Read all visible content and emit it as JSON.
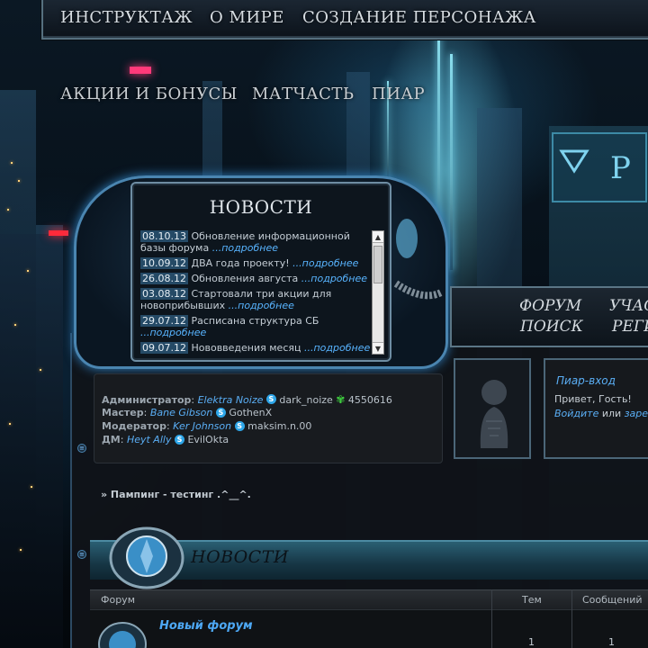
{
  "nav": {
    "row1": [
      "ИНСТРУКТАЖ",
      "О МИРЕ",
      "СОЗДАНИЕ ПЕРСОНАЖА"
    ],
    "row2": [
      "АКЦИИ И БОНУСЫ",
      "МАТЧАСТЬ",
      "ПИАР"
    ]
  },
  "news_widget": {
    "title": "НОВОСТИ",
    "more_label": "...подробнее",
    "items": [
      {
        "date": "08.10.13",
        "text": "Обновление информационной базы форума"
      },
      {
        "date": "10.09.12",
        "text": "ДВА года проекту!"
      },
      {
        "date": "26.08.12",
        "text": "Обновления августа"
      },
      {
        "date": "03.08.12",
        "text": "Стартовали три акции для новоприбывших"
      },
      {
        "date": "29.07.12",
        "text": "Расписана структура СБ"
      },
      {
        "date": "09.07.12",
        "text": "Нововведения месяц"
      }
    ]
  },
  "menu": {
    "forum": "ФОРУМ",
    "participants": "УЧАС",
    "search": "ПОИСК",
    "register": "РЕГИ"
  },
  "staff": [
    {
      "role": "Администратор",
      "name": "Elektra Noize",
      "skype": "dark_noize",
      "icq": "4550616"
    },
    {
      "role": "Мастер",
      "name": "Bane Gibson",
      "skype": "GothenX"
    },
    {
      "role": "Модератор",
      "name": "Ker Johnson",
      "skype": "maksim.n.00"
    },
    {
      "role": "ДМ",
      "name": "Heyt Ally",
      "skype": "EvilOkta"
    }
  ],
  "login": {
    "title": "Пиар-вход",
    "greeting": "Привет, Гость!",
    "login_link": "Войдите",
    "or": "или",
    "register_link": "заре"
  },
  "ping_text": "» Пампинг - тестинг .^__^.",
  "forum_section": {
    "title": "НОВОСТИ",
    "columns": {
      "forum": "Форум",
      "topics": "Тем",
      "posts": "Сообщений"
    },
    "rows": [
      {
        "name": "Новый форум",
        "topics": "1",
        "posts": "1"
      }
    ]
  },
  "colors": {
    "accent": "#5aaef5",
    "frame": "#4a85b0"
  }
}
